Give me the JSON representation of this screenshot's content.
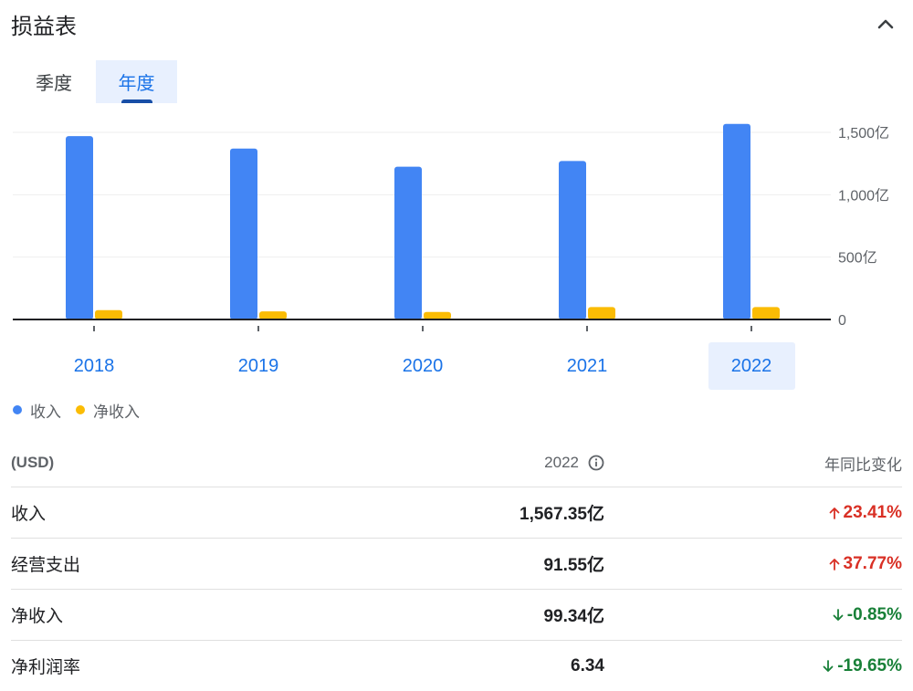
{
  "header": {
    "title": "损益表"
  },
  "tabs": [
    {
      "label": "季度",
      "active": false
    },
    {
      "label": "年度",
      "active": true
    }
  ],
  "chart_data": {
    "type": "bar",
    "categories": [
      "2018",
      "2019",
      "2020",
      "2021",
      "2022"
    ],
    "selected_category": "2022",
    "series": [
      {
        "name": "收入",
        "color": "#4285f4",
        "values": [
          1470,
          1370,
          1225,
          1270,
          1567.35
        ]
      },
      {
        "name": "净收入",
        "color": "#fbbc04",
        "values": [
          75,
          65,
          60,
          100,
          99.34
        ]
      }
    ],
    "y_ticks": [
      {
        "value": 0,
        "label": "0"
      },
      {
        "value": 500,
        "label": "500亿"
      },
      {
        "value": 1000,
        "label": "1,000亿"
      },
      {
        "value": 1500,
        "label": "1,500亿"
      }
    ],
    "ylim": [
      0,
      1500
    ],
    "grid": true,
    "legend_position": "bottom-left"
  },
  "table": {
    "header": {
      "currency": "(USD)",
      "year": "2022",
      "yoy": "年同比变化"
    },
    "rows": [
      {
        "label": "收入",
        "value": "1,567.35亿",
        "change": "23.41%",
        "direction": "up"
      },
      {
        "label": "经营支出",
        "value": "91.55亿",
        "change": "37.77%",
        "direction": "up"
      },
      {
        "label": "净收入",
        "value": "99.34亿",
        "change": "-0.85%",
        "direction": "down"
      },
      {
        "label": "净利润率",
        "value": "6.34",
        "change": "-19.65%",
        "direction": "down"
      }
    ]
  },
  "icons": {
    "collapse": "chevron-up-icon",
    "info": "info-icon",
    "up": "arrow-up-icon",
    "down": "arrow-down-icon"
  }
}
